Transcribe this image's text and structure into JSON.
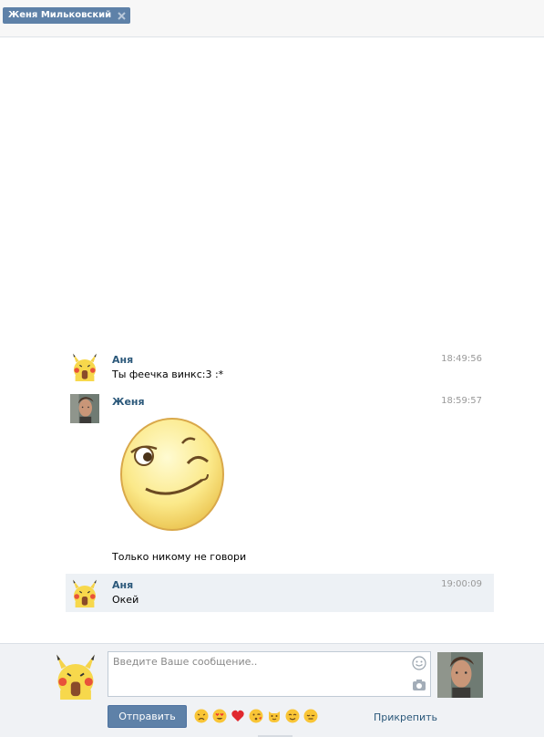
{
  "tab": {
    "label": "Женя Мильковский",
    "close_icon": "close-icon"
  },
  "messages": [
    {
      "author": "Аня",
      "time": "18:49:56",
      "text": "Ты феечка винкс:3 :*",
      "avatar": "pikachu-avatar"
    },
    {
      "author": "Женя",
      "time": "18:59:57",
      "text": "Только никому не говори",
      "avatar": "user-photo-avatar",
      "sticker": "winking-smiley-sticker"
    },
    {
      "author": "Аня",
      "time": "19:00:09",
      "text": "Окей",
      "avatar": "pikachu-avatar"
    }
  ],
  "composer": {
    "placeholder": "Введите Ваше сообщение..",
    "send_label": "Отправить",
    "attach_label": "Прикрепить",
    "emojis": [
      "disappointed-emoji",
      "heart-eyes-emoji",
      "heart-emoji",
      "kissing-wink-emoji",
      "cat-emoji",
      "blush-emoji",
      "relieved-emoji"
    ]
  },
  "colors": {
    "accent": "#5e81a8",
    "author": "#2b587a",
    "highlight": "#edf1f5"
  }
}
